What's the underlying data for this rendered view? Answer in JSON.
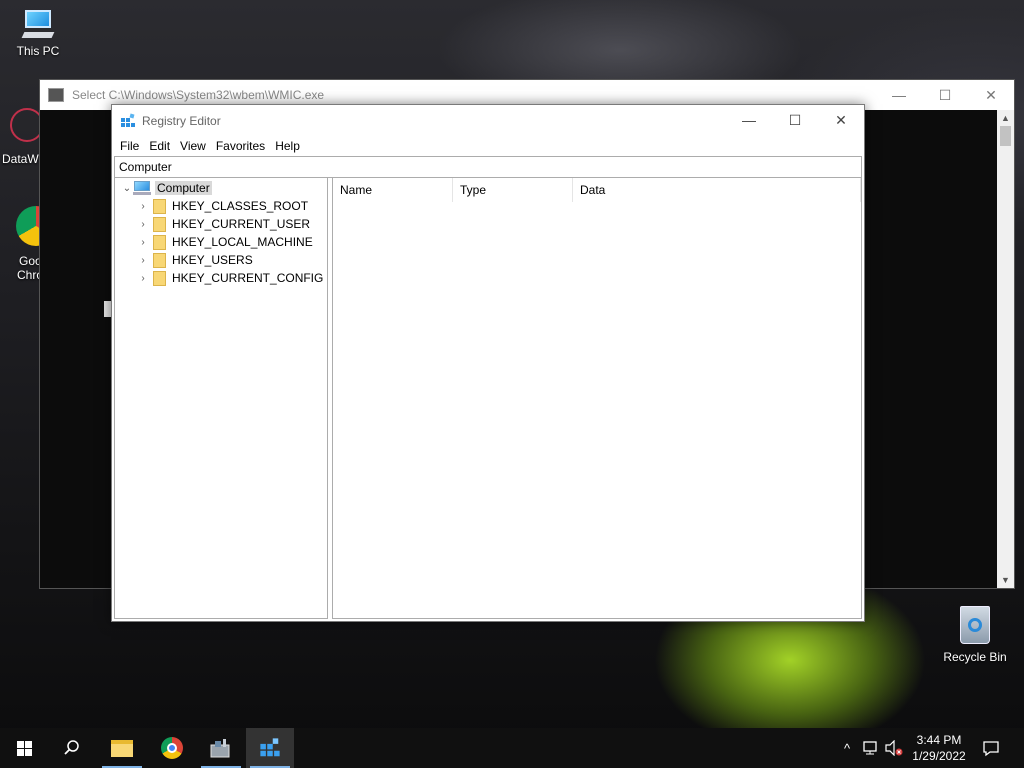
{
  "desktop": {
    "icons": [
      {
        "label": "This PC",
        "icon": "this-pc-icon"
      },
      {
        "label": "DataW",
        "icon": "datawrapper-app-icon"
      },
      {
        "label": "Goo",
        "label2": "Chro",
        "icon": "google-chrome-icon"
      },
      {
        "label": "Recycle Bin",
        "icon": "recycle-bin-icon"
      }
    ]
  },
  "console": {
    "title": "Select C:\\Windows\\System32\\wbem\\WMIC.exe",
    "minimize": "—",
    "maximize": "☐",
    "close": "✕"
  },
  "regedit": {
    "title": "Registry Editor",
    "minimize": "—",
    "maximize": "☐",
    "close": "✕",
    "menu": [
      "File",
      "Edit",
      "View",
      "Favorites",
      "Help"
    ],
    "address": "Computer",
    "tree": {
      "root": "Computer",
      "keys": [
        "HKEY_CLASSES_ROOT",
        "HKEY_CURRENT_USER",
        "HKEY_LOCAL_MACHINE",
        "HKEY_USERS",
        "HKEY_CURRENT_CONFIG"
      ]
    },
    "columns": [
      "Name",
      "Type",
      "Data"
    ]
  },
  "taskbar": {
    "clock": {
      "time": "3:44 PM",
      "date": "1/29/2022"
    },
    "tray_chevron": "^",
    "notification": "☐"
  },
  "colors": {
    "accent": "#7fb3e6",
    "folder": "#f8d775",
    "taskbar": "#101010"
  }
}
